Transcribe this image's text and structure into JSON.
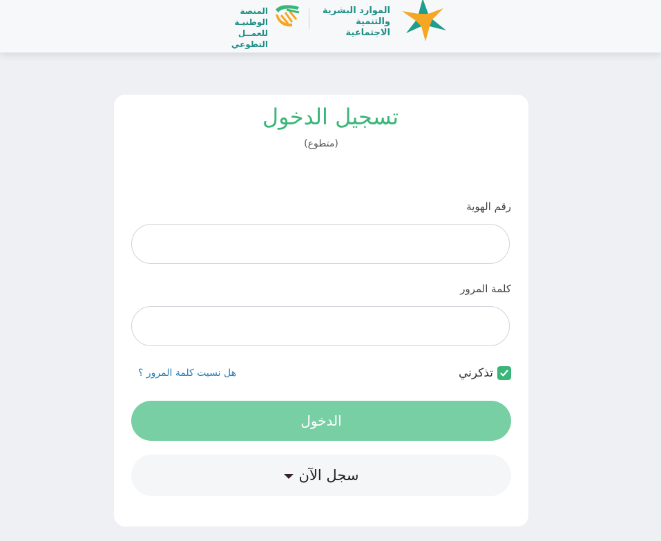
{
  "header": {
    "ministry_name_line1": "الموارد البشرية",
    "ministry_name_line2": "والتنمية الاجتماعية",
    "platform_name_line1": "المنصة الوطنيـة",
    "platform_name_line2": "للعمــل التطوعي"
  },
  "login": {
    "title": "تسجيل الدخول",
    "subtitle": "(متطوع)",
    "id_label": "رقم الهوية",
    "id_value": "",
    "password_label": "كلمة المرور",
    "password_value": "",
    "remember_label": "تذكرني",
    "remember_checked": true,
    "forgot_link": "هل نسيت كلمة المرور ؟",
    "submit_label": "الدخول",
    "register_label": "سجل الآن"
  },
  "colors": {
    "accent": "#3ab679",
    "button": "#78cfa3",
    "link": "#2a7fb8",
    "page_bg": "#eef0f4"
  }
}
